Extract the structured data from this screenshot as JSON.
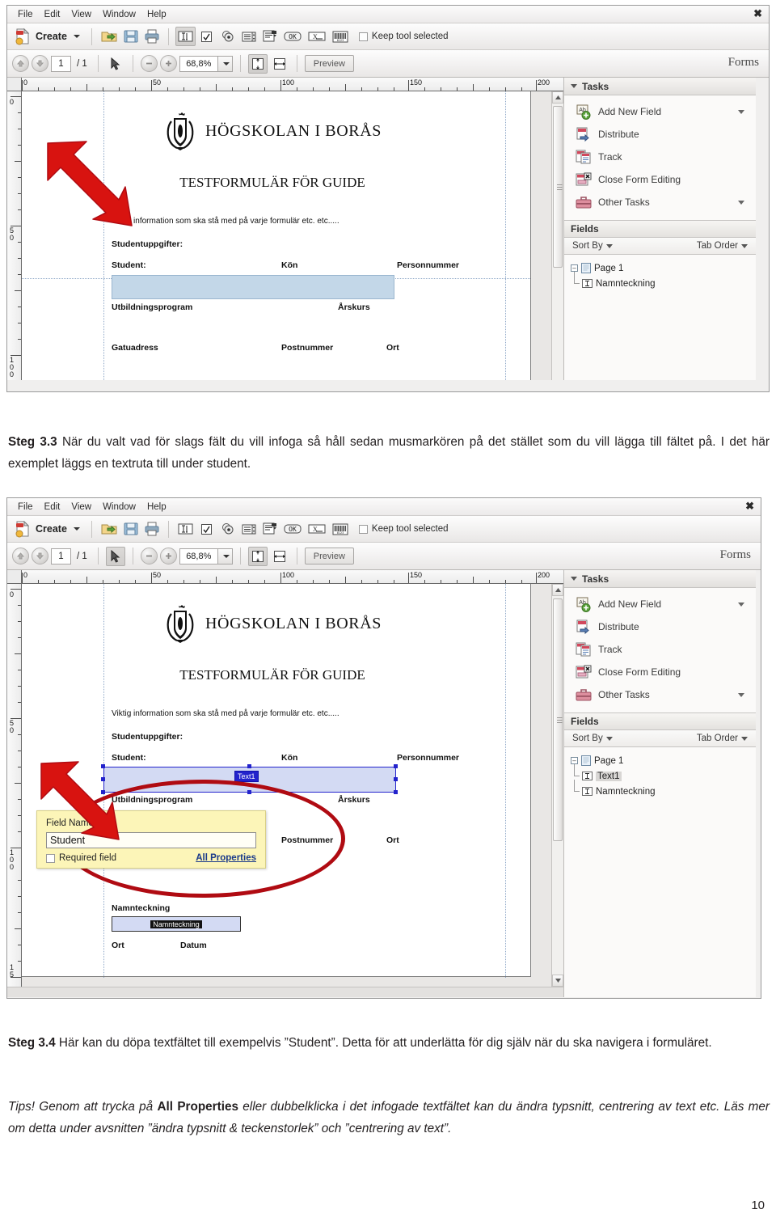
{
  "document": {
    "page_number": "10",
    "paragraphs": {
      "step33_label": "Steg 3.3",
      "step33_text": " När du valt vad för slags fält du vill infoga så håll sedan musmarkören på det stället som du vill lägga till fältet på. I det här exemplet läggs en textruta till under student.",
      "step34_label": "Steg 3.4",
      "step34_text": " Här kan du döpa textfältet till exempelvis ”Student”. Detta för att underlätta för dig själv när du ska navigera i formuläret.",
      "tips_lead": "Tips! Genom att trycka på ",
      "tips_bold": "All Properties",
      "tips_rest": " eller dubbelklicka i det infogade textfältet kan du ändra typsnitt, centrering av text etc. Läs mer om detta under avsnitten ”ändra typsnitt & teckenstorlek” och ”centrering av text”."
    }
  },
  "app": {
    "menu": [
      "File",
      "Edit",
      "View",
      "Window",
      "Help"
    ],
    "close_label": "✖",
    "toolbar": {
      "create_label": "Create",
      "keep_tool_label": "Keep tool selected",
      "icons": [
        "create-pdf-icon",
        "open-folder-icon",
        "save-icon",
        "print-icon",
        "text-field-icon",
        "checkbox-field-icon",
        "radio-button-field-icon",
        "list-box-field-icon",
        "dropdown-field-icon",
        "button-field-icon",
        "digital-signature-field-icon",
        "barcode-field-icon"
      ]
    },
    "navbar": {
      "page_current": "1",
      "page_total": "/ 1",
      "zoom_value": "68,8%",
      "preview_label": "Preview",
      "mode_label": "Forms",
      "icons": [
        "previous-page-icon",
        "next-page-icon",
        "select-tool-icon",
        "zoom-out-icon",
        "zoom-in-icon",
        "fit-page-icon",
        "fit-width-icon"
      ]
    },
    "rulers": {
      "horizontal_labels": [
        "0",
        "50",
        "100",
        "150",
        "200"
      ],
      "vertical_labels_shot1": [
        "0",
        "50",
        "100"
      ],
      "vertical_labels_shot2": [
        "0",
        "50",
        "100",
        "15"
      ]
    },
    "taskpane": {
      "tasks_header": "Tasks",
      "tasks": [
        {
          "label": "Add New Field",
          "icon": "add-new-field-icon",
          "has_dropdown": true
        },
        {
          "label": "Distribute",
          "icon": "distribute-icon",
          "has_dropdown": false
        },
        {
          "label": "Track",
          "icon": "track-icon",
          "has_dropdown": false
        },
        {
          "label": "Close Form Editing",
          "icon": "close-form-editing-icon",
          "has_dropdown": false
        },
        {
          "label": "Other Tasks",
          "icon": "other-tasks-icon",
          "has_dropdown": true
        }
      ],
      "fields_header": "Fields",
      "sort_by_label": "Sort By",
      "tab_order_label": "Tab Order",
      "tree_shot1": {
        "root": "Page 1",
        "children": [
          "Namnteckning"
        ]
      },
      "tree_shot2": {
        "root": "Page 1",
        "children": [
          "Text1",
          "Namnteckning"
        ]
      }
    }
  },
  "pdf_page": {
    "university": "HÖGSKOLAN I BORÅS",
    "title": "TESTFORMULÄR FÖR GUIDE",
    "info_line": "Viktig information som ska stå med på varje formulär etc. etc.....",
    "section_label": "Studentuppgifter:",
    "labels": {
      "student": "Student:",
      "kon": "Kön",
      "personnummer": "Personnummer",
      "utbildningsprogram": "Utbildningsprogram",
      "arskurs": "Årskurs",
      "gatuadress": "Gatuadress",
      "postnummer": "Postnummer",
      "ort": "Ort",
      "namnteckning": "Namnteckning",
      "datum": "Datum"
    },
    "fields": {
      "text1_caption": "Text1",
      "namnteckning_value": "Namnteckning"
    }
  },
  "popup": {
    "field_name_label": "Field Name:",
    "field_name_value": "Student",
    "required_label": "Required field",
    "all_properties_label": "All Properties"
  },
  "colors": {
    "annotation_red": "#b00b12",
    "selection_blue": "#2323cc",
    "field_fill": "#c3d7e8",
    "popup_yellow": "#fcf5b8"
  }
}
